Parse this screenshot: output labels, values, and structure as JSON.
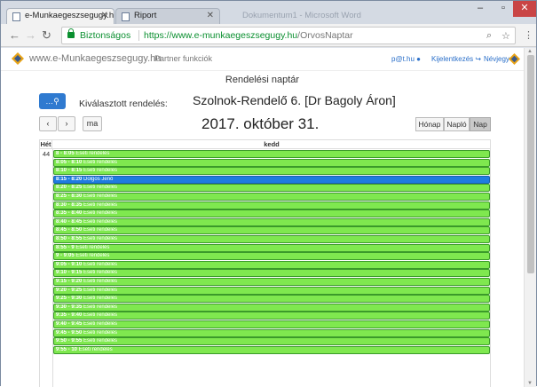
{
  "browser": {
    "tabs": [
      {
        "title": "e-Munkaegeszsegugy.hu",
        "active": true
      },
      {
        "title": "Riport",
        "active": false
      }
    ],
    "ghost_tab": "Dokumentum1 - Microsoft Word",
    "secure_label": "Biztonságos",
    "url_domain": "https://www.e-munkaegeszsegugy.hu",
    "url_path": "/OrvosNaptar"
  },
  "site": {
    "brand": "www.e-Munkaegeszsegugy.hu",
    "partner_menu": "Partner funkciók",
    "user": "p@t.hu",
    "logout": "Kijelentkezés",
    "directory": "Névjegy",
    "brand_color": "#e8a317"
  },
  "page": {
    "title": "Rendelési naptár",
    "selected_label": "Kiválasztott rendelés:",
    "selected_value": "Szolnok-Rendelő 6. [Dr Bagoly Áron]",
    "today_label": "ma",
    "date_title": "2017. október 31.",
    "views": [
      {
        "label": "Hónap",
        "active": false
      },
      {
        "label": "Napló",
        "active": false
      },
      {
        "label": "Nap",
        "active": true
      }
    ]
  },
  "calendar": {
    "week_header": "Hét",
    "day_header": "kedd",
    "week_number": "44",
    "events": [
      {
        "time": "8 - 8:05",
        "title": "Eseti rendelés",
        "selected": false
      },
      {
        "time": "8:05 - 8:10",
        "title": "Eseti rendelés",
        "selected": false
      },
      {
        "time": "8:10 - 8:15",
        "title": "Eseti rendelés",
        "selected": false
      },
      {
        "time": "8:15 - 8:20",
        "title": "Dolgos Jenő",
        "selected": true
      },
      {
        "time": "8:20 - 8:25",
        "title": "Eseti rendelés",
        "selected": false
      },
      {
        "time": "8:25 - 8:30",
        "title": "Eseti rendelés",
        "selected": false
      },
      {
        "time": "8:30 - 8:35",
        "title": "Eseti rendelés",
        "selected": false
      },
      {
        "time": "8:35 - 8:40",
        "title": "Eseti rendelés",
        "selected": false
      },
      {
        "time": "8:40 - 8:45",
        "title": "Eseti rendelés",
        "selected": false
      },
      {
        "time": "8:45 - 8:50",
        "title": "Eseti rendelés",
        "selected": false
      },
      {
        "time": "8:50 - 8:55",
        "title": "Eseti rendelés",
        "selected": false
      },
      {
        "time": "8:55 - 9",
        "title": "Eseti rendelés",
        "selected": false
      },
      {
        "time": "9 - 9:05",
        "title": "Eseti rendelés",
        "selected": false
      },
      {
        "time": "9:05 - 9:10",
        "title": "Eseti rendelés",
        "selected": false
      },
      {
        "time": "9:10 - 9:15",
        "title": "Eseti rendelés",
        "selected": false
      },
      {
        "time": "9:15 - 9:20",
        "title": "Eseti rendelés",
        "selected": false
      },
      {
        "time": "9:20 - 9:25",
        "title": "Eseti rendelés",
        "selected": false
      },
      {
        "time": "9:25 - 9:30",
        "title": "Eseti rendelés",
        "selected": false
      },
      {
        "time": "9:30 - 9:35",
        "title": "Eseti rendelés",
        "selected": false
      },
      {
        "time": "9:35 - 9:40",
        "title": "Eseti rendelés",
        "selected": false
      },
      {
        "time": "9:40 - 9:45",
        "title": "Eseti rendelés",
        "selected": false
      },
      {
        "time": "9:45 - 9:50",
        "title": "Eseti rendelés",
        "selected": false
      },
      {
        "time": "9:50 - 9:55",
        "title": "Eseti rendelés",
        "selected": false
      },
      {
        "time": "9:55 - 10",
        "title": "Eseti rendelés",
        "selected": false
      }
    ]
  }
}
